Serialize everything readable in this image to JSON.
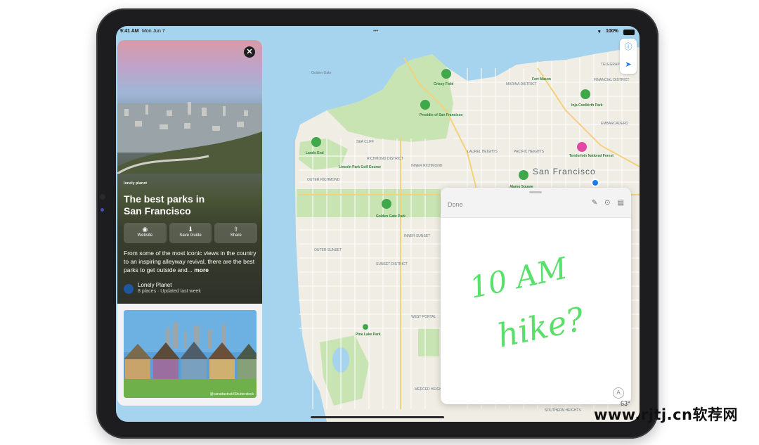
{
  "status_bar": {
    "time": "9:41 AM",
    "date": "Mon Jun 7",
    "battery": "100%",
    "multitask_dots": "•••"
  },
  "guide_card": {
    "brand": "lonely planet",
    "title_line1": "The best parks in",
    "title_line2": "San Francisco",
    "close_icon": "close-icon",
    "actions": [
      {
        "label": "Website",
        "icon": "compass-icon"
      },
      {
        "label": "Save Guide",
        "icon": "save-icon"
      },
      {
        "label": "Share",
        "icon": "share-icon"
      }
    ],
    "description": "From some of the most iconic views in the country to an inspiring alleyway revival, there are the best parks to get outside and...",
    "more_label": "more",
    "publisher": "Lonely Planet",
    "publisher_meta": "8 places · Updated last week",
    "photo_credit": "@canadastock/Shutterstock"
  },
  "map_controls": {
    "info_icon": "info-icon",
    "location_icon": "location-arrow-icon"
  },
  "map_labels": {
    "city": "San Francisco",
    "golden_gate": "Golden Gate",
    "crissy_field": "Crissy Field",
    "marina": "MARINA DISTRICT",
    "fort_mason": "Fort Mason",
    "coit": "Inja Coolbirth Park",
    "presidio": "Presidio of San Francisco",
    "sea_cliff": "SEA CLIFF",
    "lands_end": "Lands End",
    "richmond": "RICHMOND DISTRICT",
    "lincoln": "Lincoln Park Golf Course",
    "outer_richmond": "OUTER RICHMOND",
    "inner_richmond": "INNER RICHMOND",
    "laurel": "LAUREL HEIGHTS",
    "pacific": "PACIFIC HEIGHTS",
    "tenderloin": "Tenderloin National Forest",
    "alamo": "Alamo Square",
    "golden_gate_park": "Golden Gate Park",
    "inner_sunset": "INNER SUNSET",
    "sunset": "SUNSET DISTRICT",
    "outer_sunset": "OUTER SUNSET",
    "west_portal": "WEST PORTAL",
    "pine_lake": "Pine Lake Park",
    "merced": "MERCED HEIGHTS",
    "southern_heights": "SOUTHERN HEIGHTS",
    "telegraph": "TELEGRAPH HILL",
    "embarcadero": "EMBARCADERO",
    "financial": "FINANCIAL DISTRICT"
  },
  "quick_note": {
    "done_label": "Done",
    "handwriting_line1": "10 AM",
    "handwriting_line2": "hike?",
    "toolbar_icons": [
      "compose-icon",
      "more-icon",
      "notes-icon"
    ],
    "markup_icon": "markup-icon"
  },
  "weather": "63°",
  "watermark": "www.rjtj.cn软荐网",
  "colors": {
    "water": "#a6d3ee",
    "land": "#f0ede4",
    "park": "#c9e4b3",
    "pin_green": "#3fa84a",
    "handwriting": "#59e06a",
    "accent": "#1a7cf2"
  }
}
